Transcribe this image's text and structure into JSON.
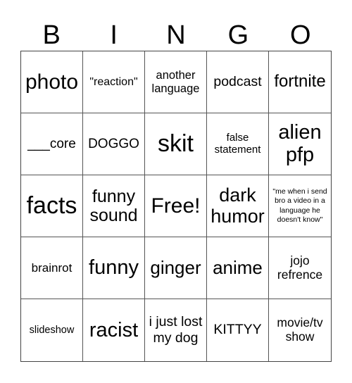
{
  "header": {
    "letters": [
      "B",
      "I",
      "N",
      "G",
      "O"
    ]
  },
  "cells": [
    {
      "text": "photo",
      "size": "l"
    },
    {
      "text": "\"reaction\"",
      "size": "s"
    },
    {
      "text": "another language",
      "size": "s"
    },
    {
      "text": "podcast",
      "size": "m"
    },
    {
      "text": "fortnite",
      "size": "m"
    },
    {
      "text": "___core",
      "size": "m"
    },
    {
      "text": "DOGGO",
      "size": "m"
    },
    {
      "text": "skit",
      "size": "xl"
    },
    {
      "text": "false statement",
      "size": "s"
    },
    {
      "text": "alien pfp",
      "size": "l"
    },
    {
      "text": "facts",
      "size": "xl"
    },
    {
      "text": "funny sound",
      "size": "l"
    },
    {
      "text": "Free!",
      "size": "l"
    },
    {
      "text": "dark humor",
      "size": "l"
    },
    {
      "text": "\"me when i send bro a video in a language he doesn't know\"",
      "size": "xs"
    },
    {
      "text": "brainrot",
      "size": "s"
    },
    {
      "text": "funny",
      "size": "l"
    },
    {
      "text": "ginger",
      "size": "l"
    },
    {
      "text": "anime",
      "size": "l"
    },
    {
      "text": "jojo refrence",
      "size": "s"
    },
    {
      "text": "slideshow",
      "size": "s"
    },
    {
      "text": "racist",
      "size": "l"
    },
    {
      "text": "i just lost my dog",
      "size": "m"
    },
    {
      "text": "KITTYY",
      "size": "m"
    },
    {
      "text": "movie/tv show",
      "size": "s"
    }
  ]
}
